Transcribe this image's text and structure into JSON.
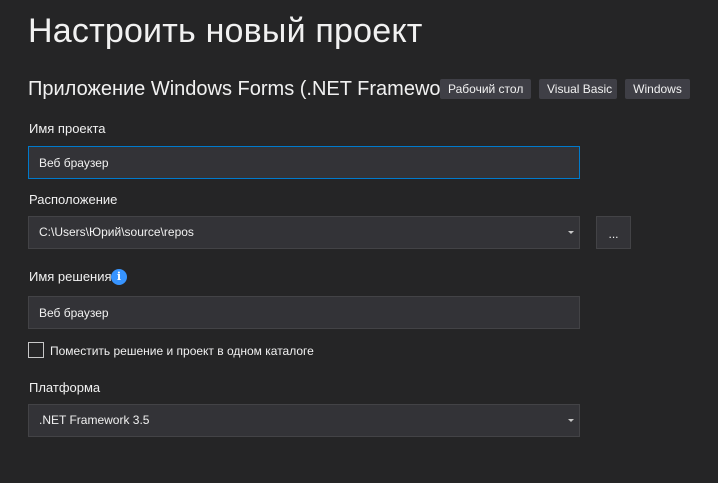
{
  "header": {
    "title": "Настроить новый проект",
    "template_name": "Приложение Windows Forms (.NET Framework)",
    "tags": [
      "Рабочий стол",
      "Visual Basic",
      "Windows"
    ]
  },
  "project_name": {
    "label": "Имя проекта",
    "value": "Веб браузер"
  },
  "location": {
    "label": "Расположение",
    "value": "C:\\Users\\Юрий\\source\\repos",
    "browse_label": "..."
  },
  "solution_name": {
    "label": "Имя решения",
    "value": "Веб браузер",
    "info_icon": "i"
  },
  "same_directory": {
    "label": "Поместить решение и проект в одном каталоге",
    "checked": false
  },
  "platform": {
    "label": "Платформа",
    "value": ".NET Framework 3.5"
  },
  "colors": {
    "background": "#252526",
    "field": "#333337",
    "focus_border": "#007acc",
    "info": "#3794ff"
  }
}
